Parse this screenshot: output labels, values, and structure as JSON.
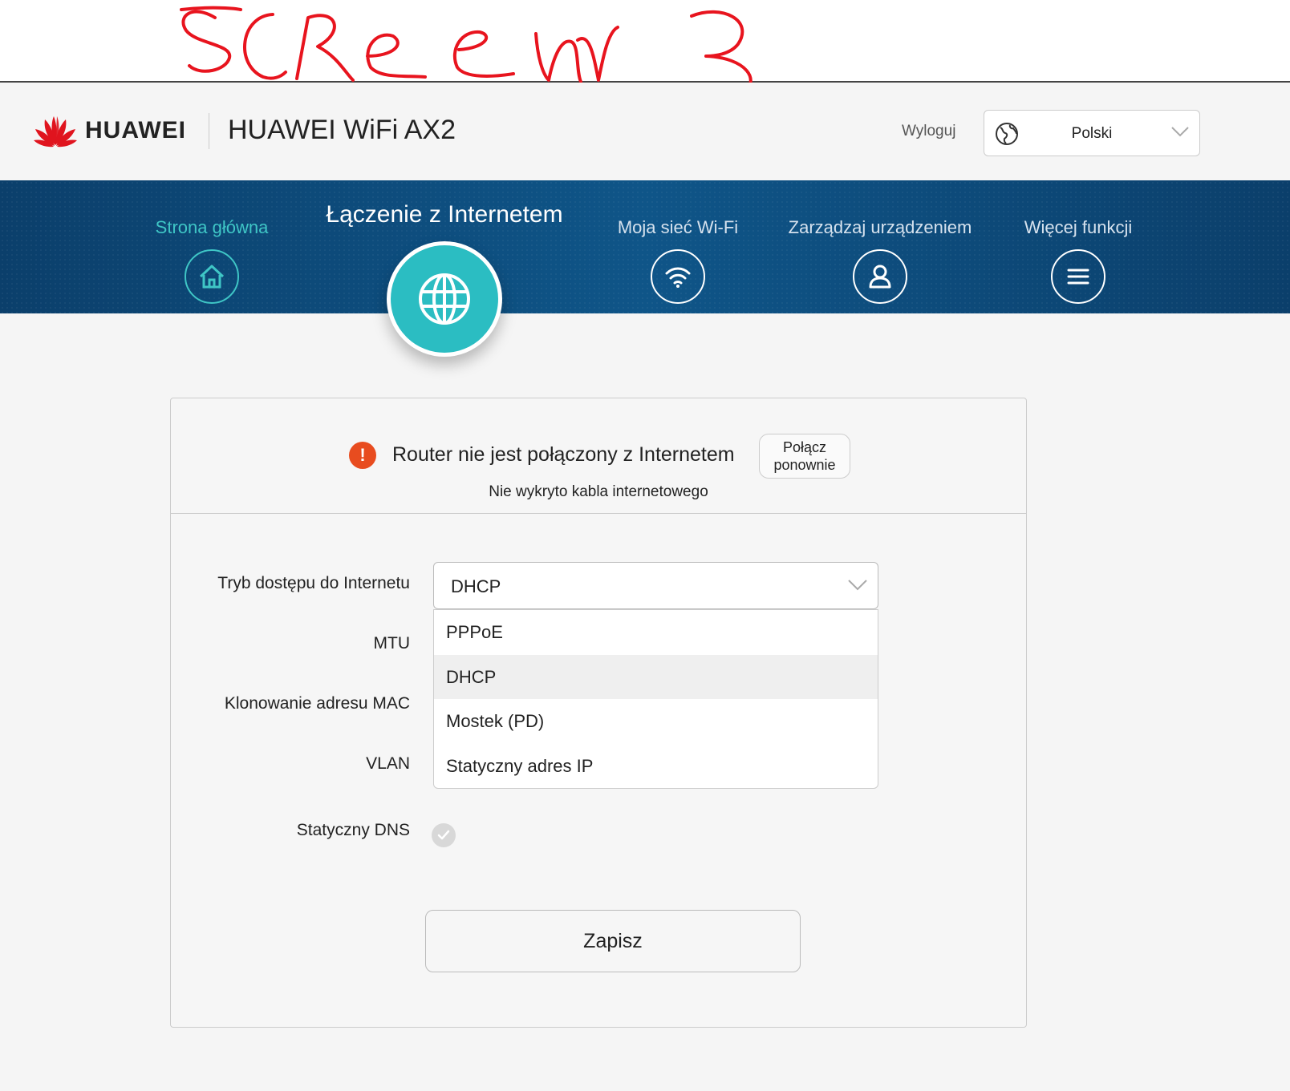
{
  "annotation": {
    "handwritten_text": "SCREEN 3"
  },
  "header": {
    "brand": "HUAWEI",
    "product": "HUAWEI WiFi AX2",
    "logout": "Wyloguj",
    "language": {
      "selected": "Polski",
      "icon": "globe-icon"
    }
  },
  "nav": {
    "items": [
      {
        "label": "Strona główna",
        "icon": "home-icon",
        "active": false
      },
      {
        "label": "Łączenie z Internetem",
        "icon": "globe-icon",
        "active": true
      },
      {
        "label": "Moja sieć Wi-Fi",
        "icon": "wifi-icon",
        "active": false
      },
      {
        "label": "Zarządzaj urządzeniem",
        "icon": "user-icon",
        "active": false
      },
      {
        "label": "Więcej funkcji",
        "icon": "menu-icon",
        "active": false
      }
    ]
  },
  "status": {
    "message": "Router nie jest połączony z Internetem",
    "reconnect_line1": "Połącz",
    "reconnect_line2": "ponownie",
    "detail": "Nie wykryto kabla internetowego"
  },
  "form": {
    "labels": {
      "access_mode": "Tryb dostępu do Internetu",
      "mtu": "MTU",
      "mac_clone": "Klonowanie adresu MAC",
      "vlan": "VLAN",
      "static_dns": "Statyczny DNS"
    },
    "access_mode": {
      "selected": "DHCP",
      "options": [
        "PPPoE",
        "DHCP",
        "Mostek (PD)",
        "Statyczny adres IP"
      ]
    },
    "static_dns_enabled": false,
    "save_label": "Zapisz"
  },
  "colors": {
    "accent": "#2bbdc2",
    "nav_bg": "#0f5588",
    "warning": "#e84c1f",
    "brand_red": "#e0141e",
    "annotation": "#e8141e"
  }
}
